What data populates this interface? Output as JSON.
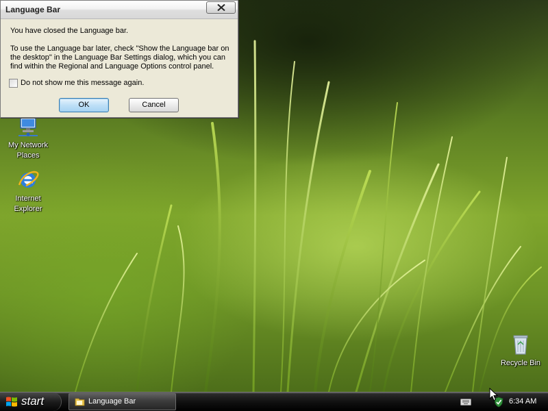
{
  "dialog": {
    "title": "Language Bar",
    "heading": "You have closed the Language bar.",
    "detail": "To use the Language bar later, check \"Show the Language bar on the desktop\" in the Language Bar Settings dialog, which you can find within the Regional and Language Options control panel.",
    "checkbox_label": "Do not show me this message again.",
    "checkbox_checked": false,
    "ok_label": "OK",
    "cancel_label": "Cancel"
  },
  "desktop": {
    "icons": [
      {
        "label": "My Network Places",
        "icon": "network-places-icon"
      },
      {
        "label": "Internet Explorer",
        "icon": "internet-explorer-icon"
      },
      {
        "label": "Recycle Bin",
        "icon": "recycle-bin-icon"
      }
    ]
  },
  "taskbar": {
    "start_label": "start",
    "tasks": [
      {
        "label": "Language Bar",
        "icon": "folder-icon"
      }
    ],
    "tray": {
      "icons": [
        "keyboard-icon",
        "security-shield-icon"
      ],
      "clock": "6:34 AM"
    }
  },
  "colors": {
    "dialog_bg": "#ece9d8",
    "taskbar_bg": "#111111",
    "ok_button_accent": "#3c7fb1",
    "wallpaper_green": "#7fa52c"
  }
}
